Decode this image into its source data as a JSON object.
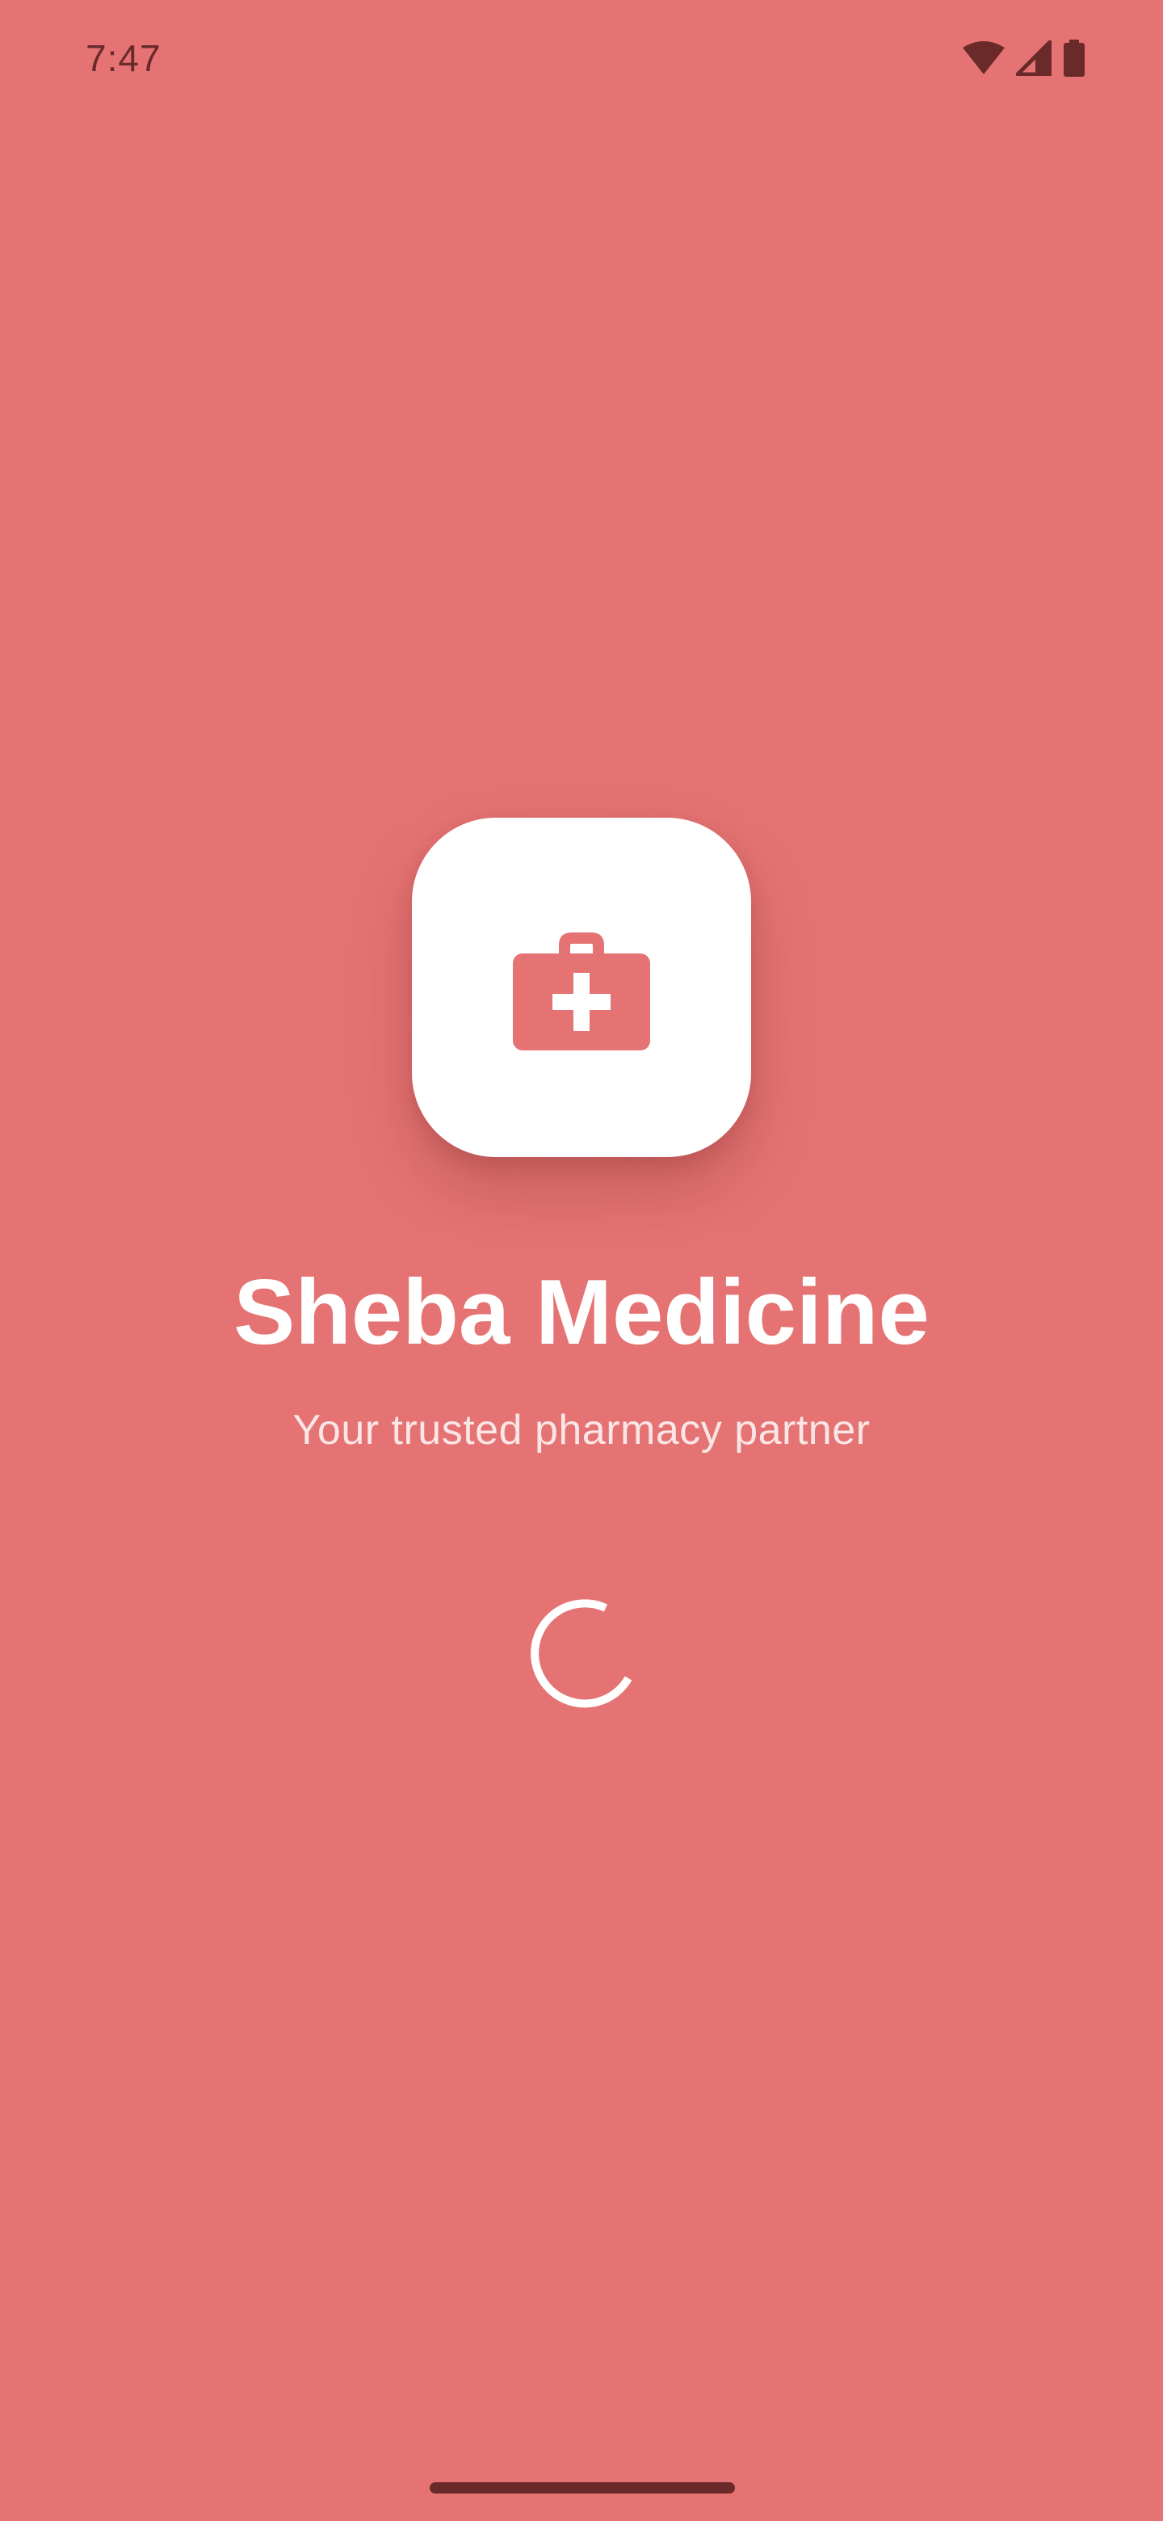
{
  "status_bar": {
    "time": "7:47",
    "icons": [
      "wifi-icon",
      "cellular-signal-icon",
      "battery-icon"
    ]
  },
  "splash": {
    "icon": "medical-kit-icon",
    "title": "Sheba Medicine",
    "subtitle": "Your trusted pharmacy partner",
    "loading_indicator": "progress-spinner"
  },
  "colors": {
    "background": "#e57373",
    "icon_tile": "#ffffff",
    "accent": "#e57373",
    "status_text": "#6b2a2a"
  }
}
